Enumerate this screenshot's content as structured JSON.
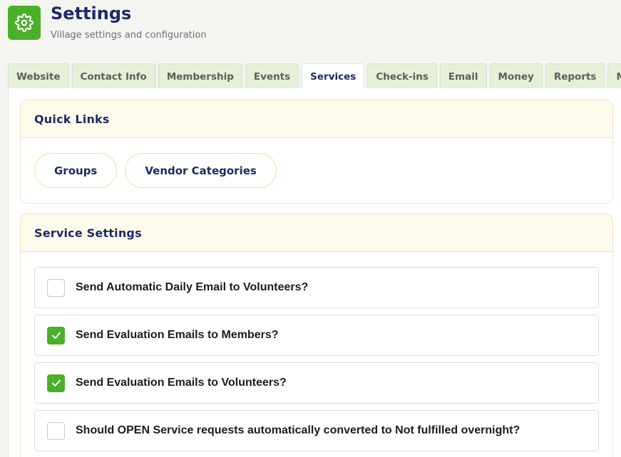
{
  "header": {
    "title": "Settings",
    "subtitle": "Village settings and configuration",
    "icon": "gear-icon",
    "accent_color": "#4caf2a"
  },
  "tabs": [
    {
      "label": "Website",
      "active": false
    },
    {
      "label": "Contact Info",
      "active": false
    },
    {
      "label": "Membership",
      "active": false
    },
    {
      "label": "Events",
      "active": false
    },
    {
      "label": "Services",
      "active": true
    },
    {
      "label": "Check-ins",
      "active": false
    },
    {
      "label": "Email",
      "active": false
    },
    {
      "label": "Money",
      "active": false
    },
    {
      "label": "Reports",
      "active": false
    },
    {
      "label": "Misc",
      "active": false
    }
  ],
  "quick_links": {
    "title": "Quick Links",
    "links": [
      {
        "label": "Groups"
      },
      {
        "label": "Vendor Categories"
      }
    ]
  },
  "service_settings": {
    "title": "Service Settings",
    "items": [
      {
        "label": "Send Automatic Daily Email to Volunteers?",
        "checked": false
      },
      {
        "label": "Send Evaluation Emails to Members?",
        "checked": true
      },
      {
        "label": "Send Evaluation Emails to Volunteers?",
        "checked": true
      },
      {
        "label": "Should OPEN Service requests automatically converted to Not fulfilled overnight?",
        "checked": false
      }
    ]
  },
  "colors": {
    "title_navy": "#1e2a64",
    "checked_green": "#4caf2a",
    "tab_bg": "#e6efd8",
    "card_header_bg": "#fdfbec"
  }
}
